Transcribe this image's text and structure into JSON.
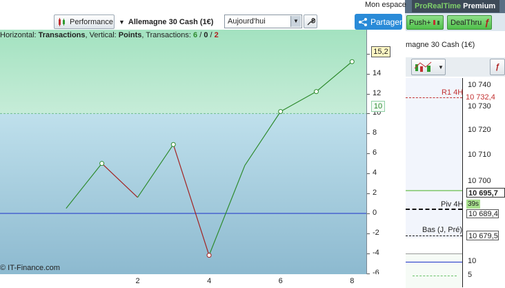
{
  "toolbar": {
    "performance_label": "Performance",
    "instrument_label": "Allemagne 30 Cash (1€)",
    "period_value": "Aujourd'hui",
    "share_label": "Partager",
    "mon_espace_label": "Mon espace",
    "prorealtime_label": "ProRealTime",
    "premium_label": "Premium",
    "push_label": "Push+",
    "dealthru_label": "DealThru"
  },
  "chart": {
    "header_prefix_h": "Horizontal: ",
    "header_h_value": "Transactions",
    "header_prefix_v": ", Vertical: ",
    "header_v_value": "Points",
    "header_prefix_t": ", Transactions: ",
    "header_t_green": "6",
    "header_t_sep1": " / ",
    "header_t_zero": "0",
    "header_t_sep2": " / ",
    "header_t_red": "2",
    "copyright": "© IT-Finance.com",
    "last_value_badge": "15,2",
    "ten_badge": "10",
    "colors": {
      "up": "#2e8b2e",
      "down": "#a22222",
      "zero": "#1a2fc9",
      "green_zone": "#a7e3c2",
      "blue_zone": "#b5d9e8"
    }
  },
  "chart_data": {
    "type": "line",
    "x": [
      0,
      1,
      2,
      3,
      4,
      5,
      6,
      7,
      8
    ],
    "y": [
      0.5,
      5,
      1.6,
      6.9,
      -4.2,
      4.8,
      10.2,
      12.2,
      15.2
    ],
    "markers_at": [
      1,
      3,
      4,
      6,
      7,
      8
    ],
    "segment_colors": [
      "up",
      "down",
      "up",
      "down",
      "up",
      "up",
      "up",
      "up"
    ],
    "ylim": [
      -6.3,
      18.4
    ],
    "xlim": [
      -1.85,
      9.5
    ],
    "y_ticks": [
      "16",
      "14",
      "12",
      "10",
      "8",
      "6",
      "4",
      "2",
      "0",
      "-2",
      "-4",
      "-6"
    ],
    "x_ticks": [
      "2",
      "4",
      "6",
      "8"
    ],
    "reference_lines": [
      0,
      10
    ]
  },
  "right_panel": {
    "title": "magne 30 Cash (1€)",
    "prices": [
      "10 740",
      "10 730",
      "10 720",
      "10 710",
      "10 700"
    ],
    "r1_label": "R1 4H",
    "r1_value": "10 732,4",
    "current_price": "10 695,7",
    "countdown": "39s",
    "piv_label": "Piv 4H",
    "piv_value_hidden": "10 689,4",
    "piv_value": "10 689,4",
    "bas_label": "Bas (J, Pré)",
    "bas_value": "10 679,5",
    "lower_ticks": [
      "10",
      "5"
    ]
  }
}
